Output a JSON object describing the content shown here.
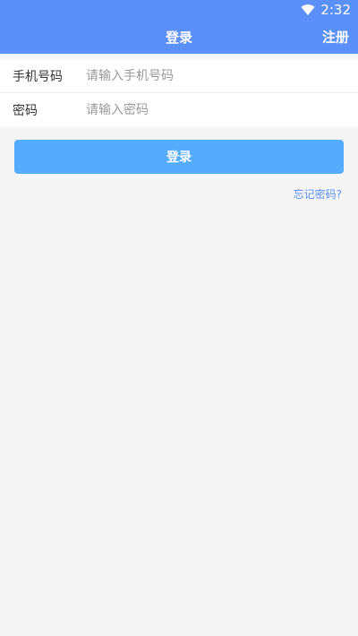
{
  "status_bar": {
    "time": "2:32",
    "wifi_icon": "wifi-icon"
  },
  "app_bar": {
    "title": "登录",
    "register_label": "注册"
  },
  "form": {
    "phone": {
      "label": "手机号码",
      "placeholder": "请输入手机号码",
      "value": ""
    },
    "password": {
      "label": "密码",
      "placeholder": "请输入密码",
      "value": ""
    }
  },
  "login_button_label": "登录",
  "forgot_password_label": "忘记密码?",
  "colors": {
    "primary": "#5b8ff9",
    "button": "#55acfd",
    "background": "#f5f5f5"
  }
}
